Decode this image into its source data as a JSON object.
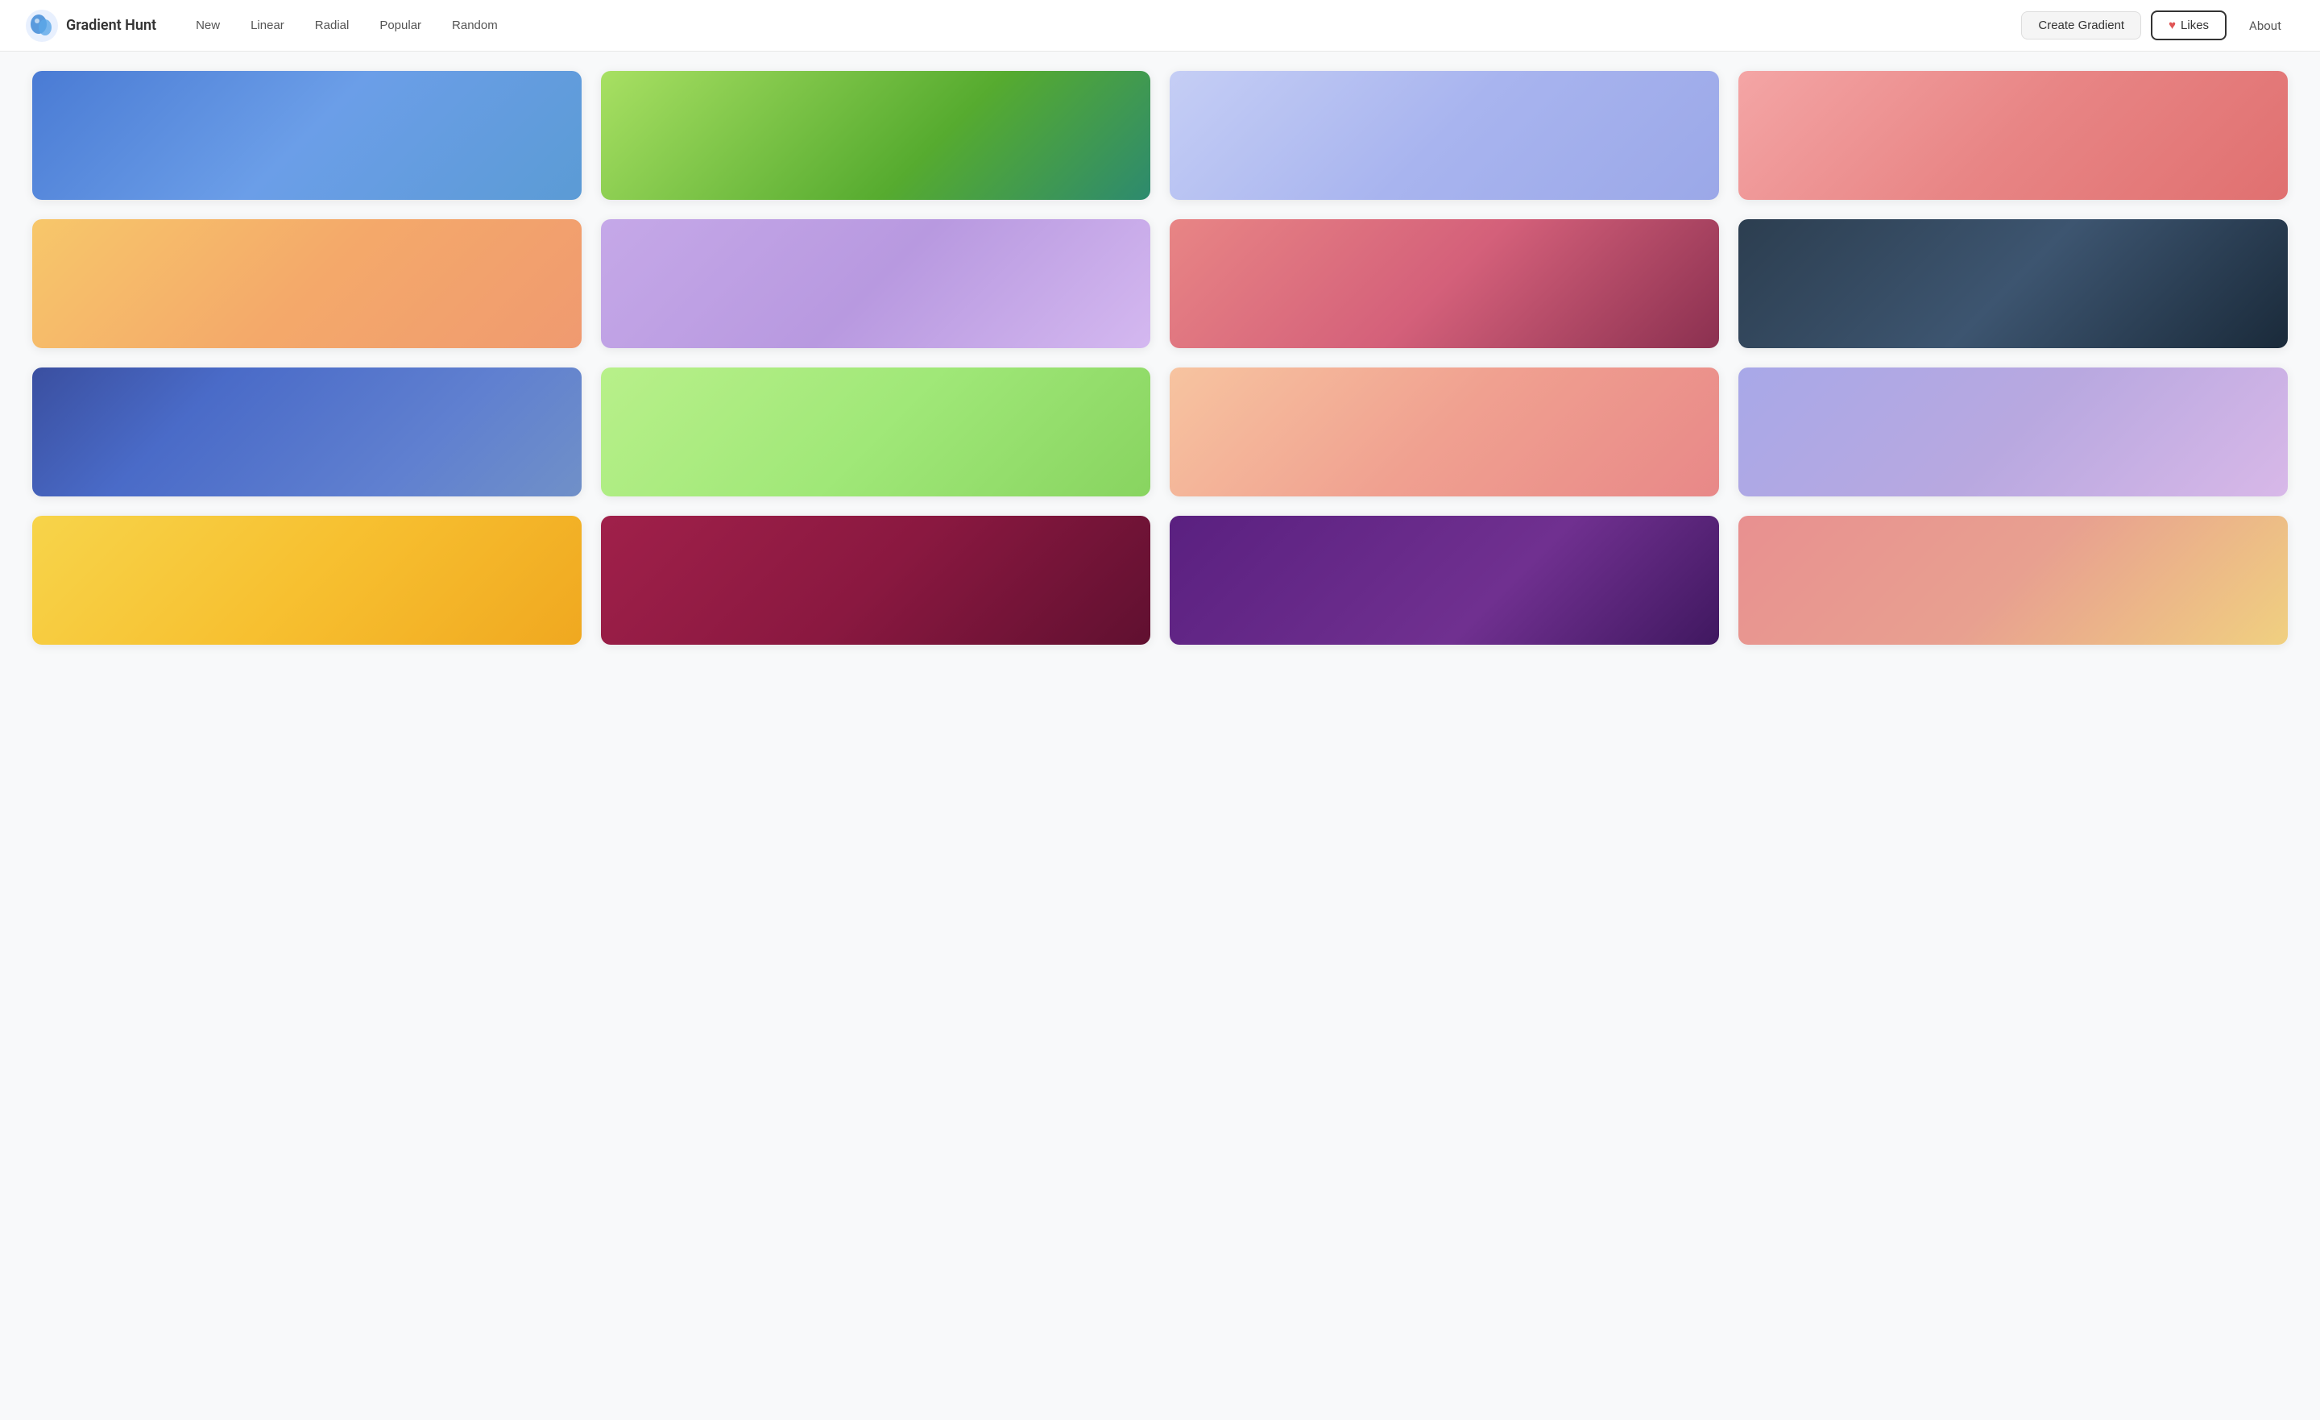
{
  "header": {
    "logo_text": "Gradient Hunt",
    "nav_items": [
      {
        "label": "New",
        "active": false
      },
      {
        "label": "Linear",
        "active": false
      },
      {
        "label": "Radial",
        "active": false
      },
      {
        "label": "Popular",
        "active": false
      },
      {
        "label": "Random",
        "active": false
      }
    ],
    "create_label": "Create Gradient",
    "likes_label": "Likes",
    "about_label": "About",
    "heart_icon": "♥"
  },
  "gradients": [
    {
      "id": 1,
      "style": "linear-gradient(135deg, #4a7bd4 0%, #6b9ee8 50%, #5b9bd5 100%)"
    },
    {
      "id": 2,
      "style": "linear-gradient(135deg, #a8e063 0%, #56ab2f 60%, #2d8a6e 100%)"
    },
    {
      "id": 3,
      "style": "linear-gradient(135deg, #c5cef5 0%, #a8b4ef 50%, #9ba8e8 100%)"
    },
    {
      "id": 4,
      "style": "linear-gradient(135deg, #f4a5a5 0%, #e88585 50%, #e07070 100%)"
    },
    {
      "id": 5,
      "style": "linear-gradient(135deg, #f7c76a 0%, #f4a96a 50%, #f09a70 100%)"
    },
    {
      "id": 6,
      "style": "linear-gradient(135deg, #c5a8e8 0%, #b899e0 50%, #d4b8f0 100%)"
    },
    {
      "id": 7,
      "style": "linear-gradient(135deg, #e88585 0%, #d4607a 50%, #8b3050 100%)"
    },
    {
      "id": 8,
      "style": "linear-gradient(135deg, #2c3e50 0%, #3d5570 50%, #1a2a3a 100%)"
    },
    {
      "id": 9,
      "style": "linear-gradient(135deg, #3a4fa0 0%, #4a6bc8 30%, #6080d0 70%, #7090c8 100%)"
    },
    {
      "id": 10,
      "style": "linear-gradient(135deg, #b8f08a 0%, #a0e878 50%, #88d460 100%)"
    },
    {
      "id": 11,
      "style": "linear-gradient(135deg, #f7c4a0 0%, #f0a090 50%, #e88888 100%)"
    },
    {
      "id": 12,
      "style": "linear-gradient(135deg, #a8a8e8 0%, #b8a8e0 50%, #d8b8e8 100%)"
    },
    {
      "id": 13,
      "style": "linear-gradient(135deg, #f7d44a 0%, #f7c030 50%, #f0a820 100%)"
    },
    {
      "id": 14,
      "style": "linear-gradient(135deg, #a0204a 0%, #8a1840 50%, #601030 100%)"
    },
    {
      "id": 15,
      "style": "linear-gradient(135deg, #5a2080 0%, #703090 60%, #401860 100%)"
    },
    {
      "id": 16,
      "style": "linear-gradient(135deg, #e89090 0%, #e8a090 50%, #f0d080 100%)"
    }
  ]
}
